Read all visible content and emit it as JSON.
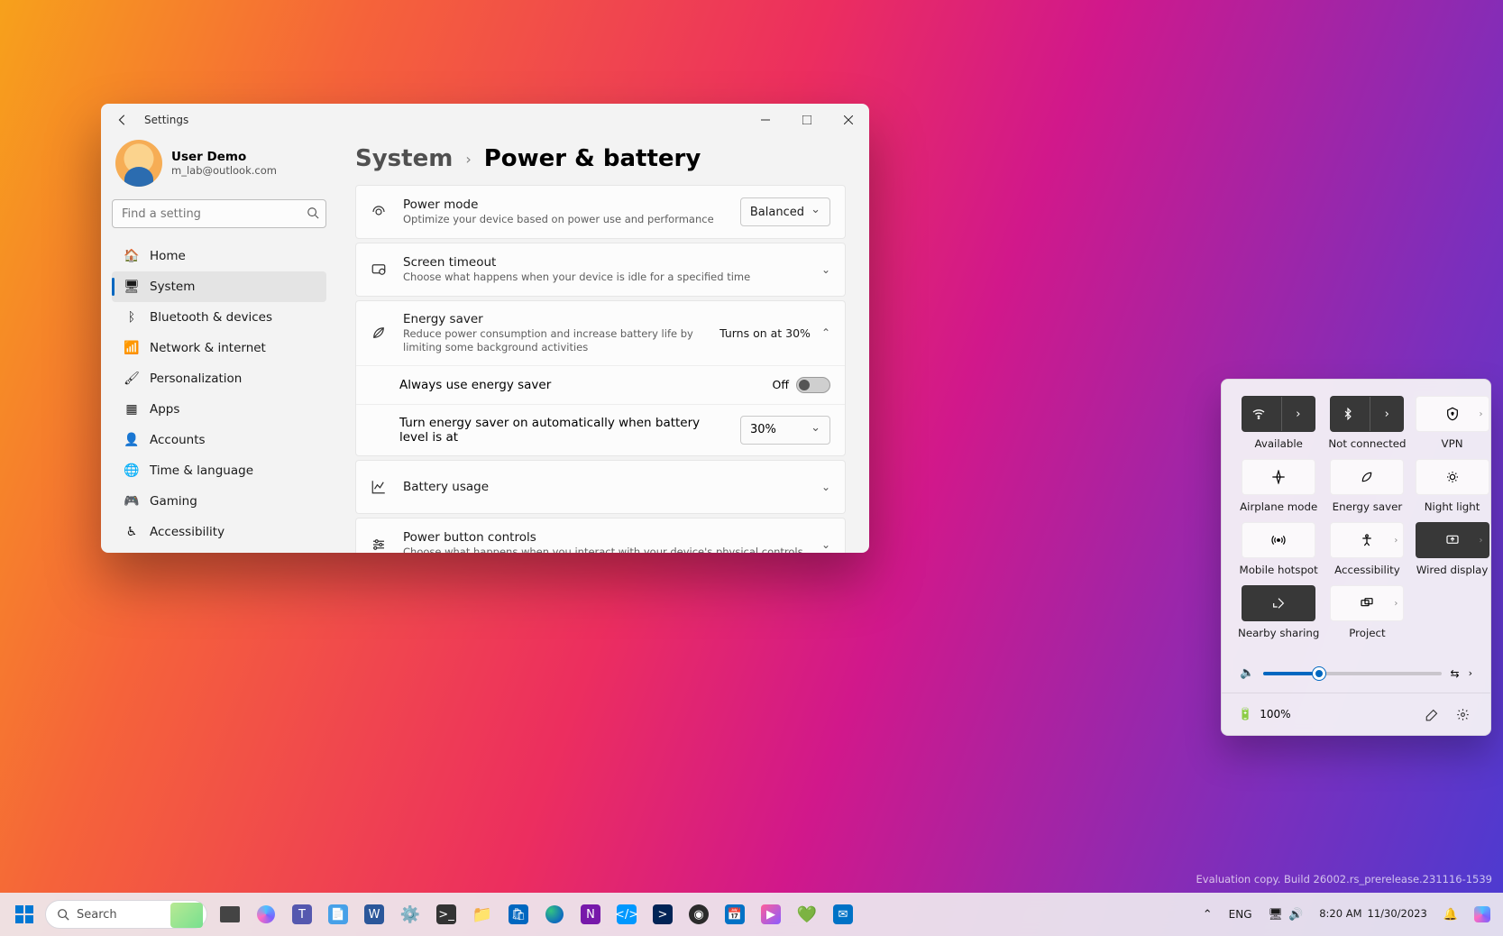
{
  "window": {
    "title": "Settings",
    "user": {
      "name": "User Demo",
      "email": "m_lab@outlook.com"
    },
    "search_placeholder": "Find a setting",
    "nav": [
      {
        "icon": "🏠",
        "label": "Home"
      },
      {
        "icon": "🖥",
        "label": "System",
        "selected": true
      },
      {
        "icon": "ᛒ",
        "label": "Bluetooth & devices"
      },
      {
        "icon": "📶",
        "label": "Network & internet"
      },
      {
        "icon": "🖌",
        "label": "Personalization"
      },
      {
        "icon": "▦",
        "label": "Apps"
      },
      {
        "icon": "👤",
        "label": "Accounts"
      },
      {
        "icon": "🌐",
        "label": "Time & language"
      },
      {
        "icon": "🎮",
        "label": "Gaming"
      },
      {
        "icon": "♿",
        "label": "Accessibility"
      }
    ],
    "breadcrumb": {
      "parent": "System",
      "current": "Power & battery"
    },
    "rows": {
      "power_mode": {
        "title": "Power mode",
        "desc": "Optimize your device based on power use and performance",
        "value": "Balanced"
      },
      "screen_timeout": {
        "title": "Screen timeout",
        "desc": "Choose what happens when your device is idle for a specified time"
      },
      "energy_saver": {
        "title": "Energy saver",
        "desc": "Reduce power consumption and increase battery life by limiting some background activities",
        "status": "Turns on at 30%"
      },
      "always_es": {
        "label": "Always use energy saver",
        "toggle": "Off"
      },
      "auto_es": {
        "label": "Turn energy saver on automatically when battery level is at",
        "value": "30%"
      },
      "battery_usage": {
        "title": "Battery usage"
      },
      "power_button": {
        "title": "Power button controls",
        "desc": "Choose what happens when you interact with your device's physical controls"
      }
    }
  },
  "flyout": {
    "tiles": [
      {
        "id": "wifi",
        "label": "Available",
        "dark": true,
        "split": true
      },
      {
        "id": "bluetooth",
        "label": "Not connected",
        "dark": true,
        "split": true
      },
      {
        "id": "vpn",
        "label": "VPN",
        "chev": true
      },
      {
        "id": "airplane",
        "label": "Airplane mode"
      },
      {
        "id": "energy",
        "label": "Energy saver"
      },
      {
        "id": "nightlight",
        "label": "Night light"
      },
      {
        "id": "hotspot",
        "label": "Mobile hotspot"
      },
      {
        "id": "accessibility",
        "label": "Accessibility",
        "chev": true
      },
      {
        "id": "wired",
        "label": "Wired display",
        "dark": true,
        "chev": true
      },
      {
        "id": "nearby",
        "label": "Nearby sharing",
        "dark": true
      },
      {
        "id": "project",
        "label": "Project",
        "chev": true
      }
    ],
    "battery": "100%"
  },
  "watermark": "Evaluation copy. Build 26002.rs_prerelease.231116-1539",
  "taskbar": {
    "search": "Search",
    "lang": "ENG",
    "time": "8:20 AM",
    "date": "11/30/2023"
  }
}
